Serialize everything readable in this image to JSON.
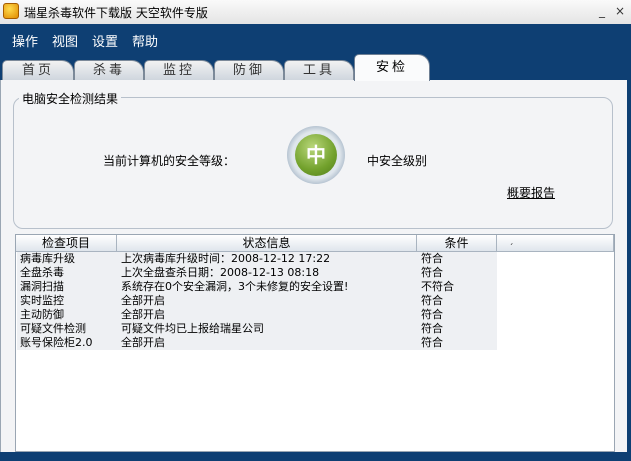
{
  "window": {
    "title": "瑞星杀毒软件下载版 天空软件专版",
    "controls": {
      "minimize": "_",
      "close": "×"
    }
  },
  "menu": [
    "操作",
    "视图",
    "设置",
    "帮助"
  ],
  "tabs": [
    "首页",
    "杀毒",
    "监控",
    "防御",
    "工具",
    "安检"
  ],
  "active_tab": "安检",
  "security": {
    "group_title": "电脑安全检测结果",
    "level_label": "当前计算机的安全等级：",
    "level_badge": "中",
    "level_value": "中安全级别",
    "report_link": "概要报告",
    "badge_color": "#72a12c"
  },
  "table": {
    "headers": [
      "检查项目",
      "状态信息",
      "条件"
    ],
    "rows": [
      {
        "item": "病毒库升级",
        "status": "上次病毒库升级时间：2008-12-12 17:22",
        "condition": "符合"
      },
      {
        "item": "全盘杀毒",
        "status": "上次全盘查杀日期：2008-12-13 08:18",
        "condition": "符合"
      },
      {
        "item": "漏洞扫描",
        "status": "系统存在0个安全漏洞，3个未修复的安全设置!",
        "condition": "不符合"
      },
      {
        "item": "实时监控",
        "status": "全部开启",
        "condition": "符合"
      },
      {
        "item": "主动防御",
        "status": "全部开启",
        "condition": "符合"
      },
      {
        "item": "可疑文件检测",
        "status": "可疑文件均已上报给瑞星公司",
        "condition": "符合"
      },
      {
        "item": "账号保险柜2.0",
        "status": "全部开启",
        "condition": "符合"
      }
    ]
  },
  "colors": {
    "frame": "#0e3f73",
    "panel": "#f3f4f6",
    "row": "#eef0f3"
  }
}
